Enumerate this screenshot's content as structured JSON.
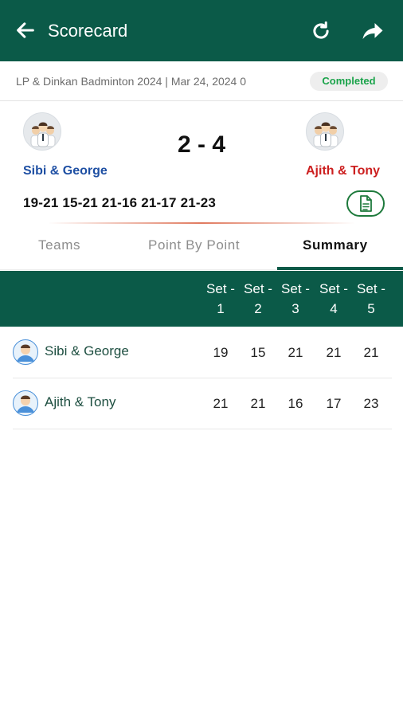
{
  "header": {
    "title": "Scorecard",
    "back_icon": "arrow-left-icon",
    "refresh_icon": "refresh-icon",
    "share_icon": "share-icon",
    "bg_color": "#0b5a48"
  },
  "match": {
    "meta": "LP & Dinkan Badminton 2024 | Mar 24, 2024 0",
    "status": "Completed",
    "team1": {
      "name": "Sibi & George",
      "color": "#1e4fa3"
    },
    "team2": {
      "name": "Ajith & Tony",
      "color": "#cc1f1f"
    },
    "score": "2 - 4",
    "set_scores": "19-21 15-21 21-16 21-17 21-23"
  },
  "tabs": [
    {
      "label": "Teams",
      "active": false
    },
    {
      "label": "Point By Point",
      "active": false
    },
    {
      "label": "Summary",
      "active": true
    }
  ],
  "summary": {
    "columns": [
      {
        "top": "Set -",
        "bottom": "1"
      },
      {
        "top": "Set -",
        "bottom": "2"
      },
      {
        "top": "Set -",
        "bottom": "3"
      },
      {
        "top": "Set -",
        "bottom": "4"
      },
      {
        "top": "Set -",
        "bottom": "5"
      }
    ],
    "rows": [
      {
        "name": "Sibi & George",
        "scores": [
          "19",
          "15",
          "21",
          "21",
          "21"
        ]
      },
      {
        "name": "Ajith & Tony",
        "scores": [
          "21",
          "21",
          "16",
          "17",
          "23"
        ]
      }
    ]
  }
}
